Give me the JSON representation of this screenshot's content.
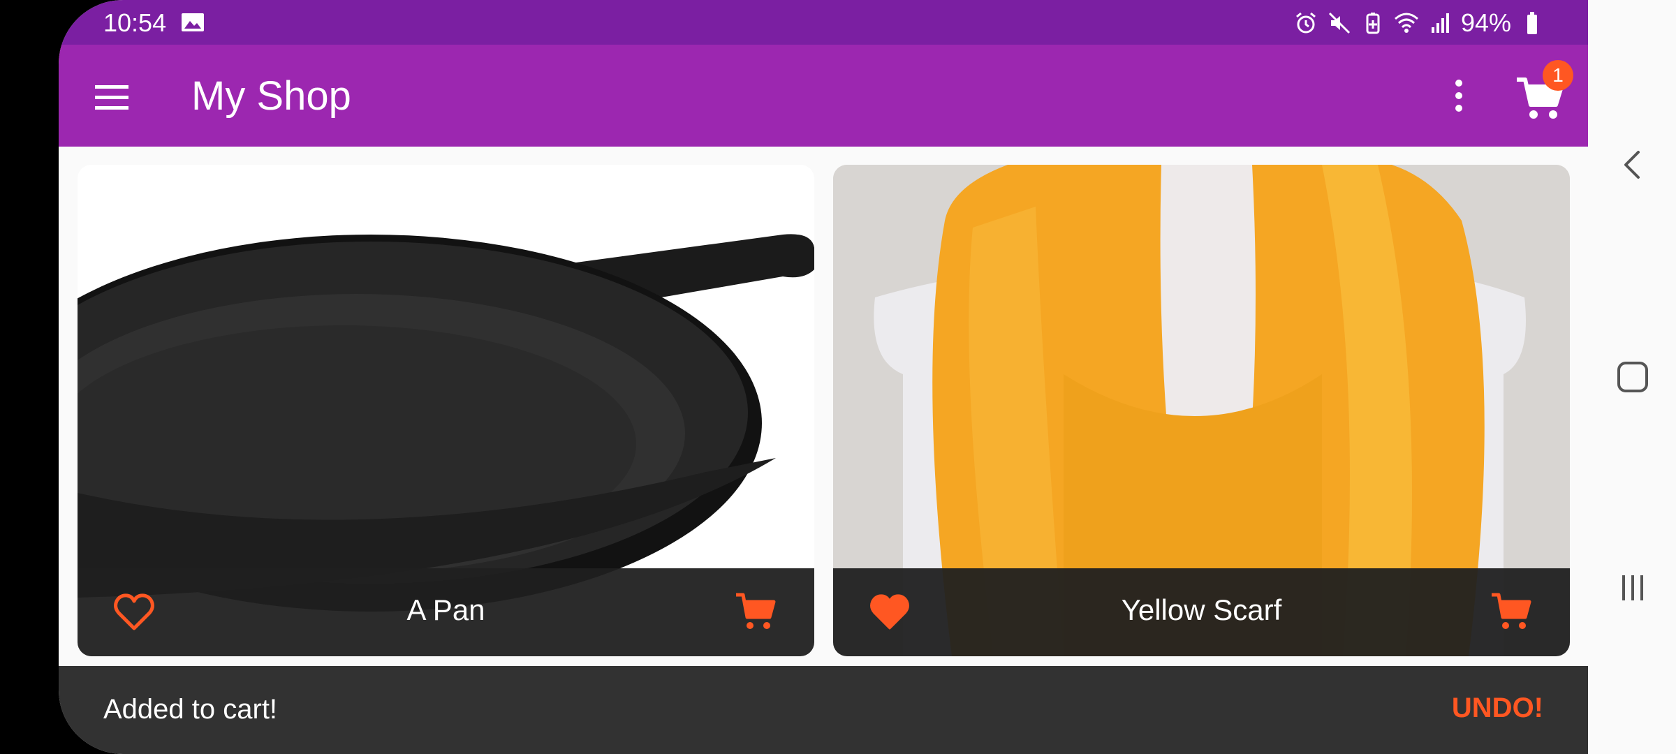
{
  "status_bar": {
    "time": "10:54",
    "battery_percent": "94%",
    "icons": [
      "gallery-icon",
      "alarm-icon",
      "mute-icon",
      "battery-saver-icon",
      "wifi-icon",
      "signal-icon",
      "battery-icon"
    ]
  },
  "app_bar": {
    "title": "My Shop",
    "menu_icon": "hamburger-menu-icon",
    "more_icon": "more-vert-icon",
    "cart_icon": "shopping-cart-icon",
    "cart_badge": "1"
  },
  "products": [
    {
      "title": "A Pan",
      "favorite": false,
      "image": "cast-iron-pan-image"
    },
    {
      "title": "Yellow Scarf",
      "favorite": true,
      "image": "yellow-scarf-image"
    }
  ],
  "snackbar": {
    "message": "Added to cart!",
    "action": "UNDO!"
  },
  "colors": {
    "status_bar": "#7b1fa2",
    "app_bar": "#9c27b0",
    "accent": "#ff5722",
    "card_footer": "#202020",
    "snackbar": "#323232"
  }
}
